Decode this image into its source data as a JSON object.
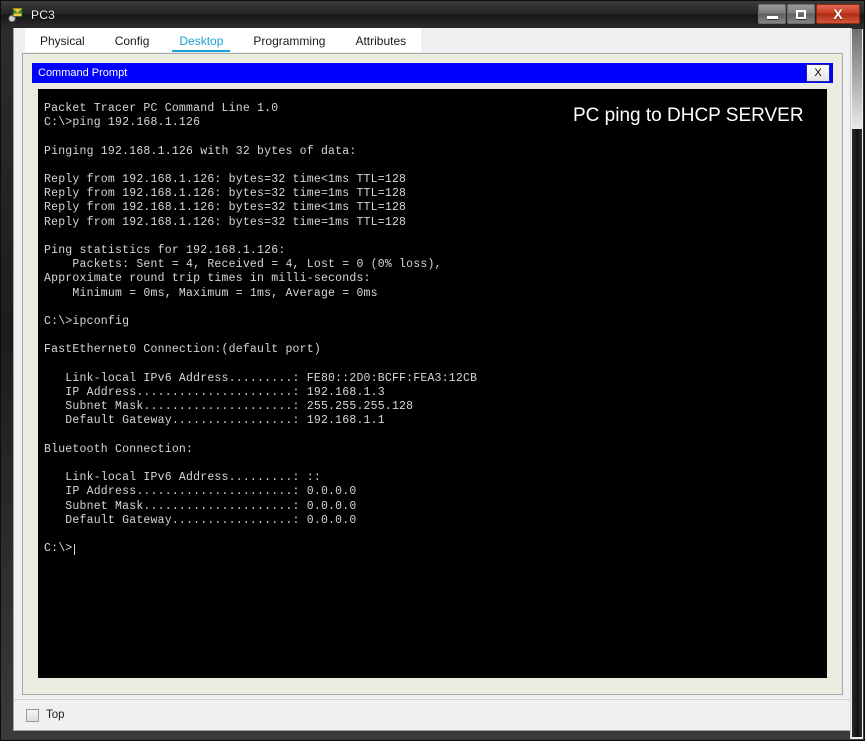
{
  "window": {
    "title": "PC3",
    "icon": "packet-tracer-pc-icon",
    "buttons": {
      "minimize": "–",
      "maximize": "□",
      "close": "X"
    }
  },
  "tabs": [
    {
      "label": "Physical",
      "active": false
    },
    {
      "label": "Config",
      "active": false
    },
    {
      "label": "Desktop",
      "active": true
    },
    {
      "label": "Programming",
      "active": false
    },
    {
      "label": "Attributes",
      "active": false
    }
  ],
  "command_prompt": {
    "title": "Command Prompt",
    "close_label": "X",
    "annotation": "PC ping to DHCP SERVER",
    "console_text": "Packet Tracer PC Command Line 1.0\nC:\\>ping 192.168.1.126\n\nPinging 192.168.1.126 with 32 bytes of data:\n\nReply from 192.168.1.126: bytes=32 time<1ms TTL=128\nReply from 192.168.1.126: bytes=32 time=1ms TTL=128\nReply from 192.168.1.126: bytes=32 time<1ms TTL=128\nReply from 192.168.1.126: bytes=32 time=1ms TTL=128\n\nPing statistics for 192.168.1.126:\n    Packets: Sent = 4, Received = 4, Lost = 0 (0% loss),\nApproximate round trip times in milli-seconds:\n    Minimum = 0ms, Maximum = 1ms, Average = 0ms\n\nC:\\>ipconfig\n\nFastEthernet0 Connection:(default port)\n\n   Link-local IPv6 Address.........: FE80::2D0:BCFF:FEA3:12CB\n   IP Address......................: 192.168.1.3\n   Subnet Mask.....................: 255.255.255.128\n   Default Gateway.................: 192.168.1.1\n\nBluetooth Connection:\n\n   Link-local IPv6 Address.........: ::\n   IP Address......................: 0.0.0.0\n   Subnet Mask.....................: 0.0.0.0\n   Default Gateway.................: 0.0.0.0\n\nC:\\>",
    "prompt_tail": "",
    "details": {
      "ping_target": "192.168.1.126",
      "bytes": "32",
      "ttl": "128",
      "packets_sent": "4",
      "packets_received": "4",
      "packets_lost": "0",
      "loss_percent": "0%",
      "rtt_minimum": "0ms",
      "rtt_maximum": "1ms",
      "rtt_average": "0ms",
      "fastethernet0": {
        "name": "FastEthernet0 Connection:(default port)",
        "link_local_ipv6": "FE80::2D0:BCFF:FEA3:12CB",
        "ip_address": "192.168.1.3",
        "subnet_mask": "255.255.255.128",
        "default_gateway": "192.168.1.1"
      },
      "bluetooth": {
        "name": "Bluetooth Connection:",
        "link_local_ipv6": "::",
        "ip_address": "0.0.0.0",
        "subnet_mask": "0.0.0.0",
        "default_gateway": "0.0.0.0"
      }
    }
  },
  "bottom": {
    "top_checkbox_label": "Top",
    "top_checkbox_checked": false
  },
  "colors": {
    "accent": "#1ba1d6",
    "cmd_titlebar": "#0000ff",
    "console_bg": "#000000",
    "console_fg": "#d6d6d6",
    "panel_bg": "#ecebdf"
  }
}
